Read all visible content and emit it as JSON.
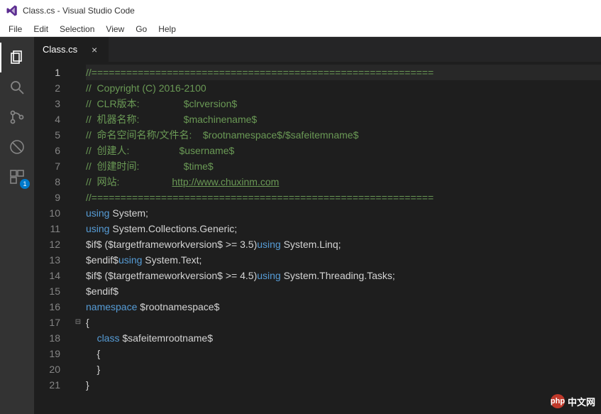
{
  "window": {
    "title": "Class.cs - Visual Studio Code"
  },
  "menu": {
    "file": "File",
    "edit": "Edit",
    "selection": "Selection",
    "view": "View",
    "go": "Go",
    "help": "Help"
  },
  "activity": {
    "explorer_badge": "1"
  },
  "tabs": {
    "tab0": {
      "label": "Class.cs"
    }
  },
  "editor": {
    "line_numbers": [
      "1",
      "2",
      "3",
      "4",
      "5",
      "6",
      "7",
      "8",
      "9",
      "10",
      "11",
      "12",
      "13",
      "14",
      "15",
      "16",
      "17",
      "18",
      "19",
      "20",
      "21"
    ],
    "current_line_index": 0,
    "fold_markers": {
      "17": "⊟"
    },
    "lines": [
      {
        "segments": [
          {
            "cls": "c-comment",
            "text": "//==========================================================="
          }
        ]
      },
      {
        "segments": [
          {
            "cls": "c-comment",
            "text": "//  Copyright (C) 2016-2100"
          }
        ]
      },
      {
        "segments": [
          {
            "cls": "c-comment",
            "text": "//  CLR版本:                $clrversion$"
          }
        ]
      },
      {
        "segments": [
          {
            "cls": "c-comment",
            "text": "//  机器名称:                $machinename$"
          }
        ]
      },
      {
        "segments": [
          {
            "cls": "c-comment",
            "text": "//  命名空间名称/文件名:    $rootnamespace$/$safeitemname$"
          }
        ]
      },
      {
        "segments": [
          {
            "cls": "c-comment",
            "text": "//  创建人:                  $username$"
          }
        ]
      },
      {
        "segments": [
          {
            "cls": "c-comment",
            "text": "//  创建时间:                $time$"
          }
        ]
      },
      {
        "segments": [
          {
            "cls": "c-comment",
            "text": "//  网站:                   "
          },
          {
            "cls": "c-link",
            "text": "http://www.chuxinm.com"
          }
        ]
      },
      {
        "segments": [
          {
            "cls": "c-comment",
            "text": "//==========================================================="
          }
        ]
      },
      {
        "segments": [
          {
            "cls": "c-keyword",
            "text": "using"
          },
          {
            "cls": "c-punc",
            "text": " System;"
          }
        ]
      },
      {
        "segments": [
          {
            "cls": "c-keyword",
            "text": "using"
          },
          {
            "cls": "c-punc",
            "text": " System.Collections.Generic;"
          }
        ]
      },
      {
        "segments": [
          {
            "cls": "c-punc",
            "text": "$if$ ($targetframeworkversion$ >= 3.5)"
          },
          {
            "cls": "c-keyword",
            "text": "using"
          },
          {
            "cls": "c-punc",
            "text": " System.Linq;"
          }
        ]
      },
      {
        "segments": [
          {
            "cls": "c-punc",
            "text": "$endif$"
          },
          {
            "cls": "c-keyword",
            "text": "using"
          },
          {
            "cls": "c-punc",
            "text": " System.Text;"
          }
        ]
      },
      {
        "segments": [
          {
            "cls": "c-punc",
            "text": "$if$ ($targetframeworkversion$ >= 4.5)"
          },
          {
            "cls": "c-keyword",
            "text": "using"
          },
          {
            "cls": "c-punc",
            "text": " System.Threading.Tasks;"
          }
        ]
      },
      {
        "segments": [
          {
            "cls": "c-punc",
            "text": "$endif$"
          }
        ]
      },
      {
        "segments": [
          {
            "cls": "c-keyword",
            "text": "namespace"
          },
          {
            "cls": "c-punc",
            "text": " $rootnamespace$"
          }
        ]
      },
      {
        "segments": [
          {
            "cls": "c-punc",
            "text": "{"
          }
        ]
      },
      {
        "segments": [
          {
            "cls": "c-punc",
            "text": "    "
          },
          {
            "cls": "c-keyword",
            "text": "class"
          },
          {
            "cls": "c-punc",
            "text": " $safeitemrootname$"
          }
        ]
      },
      {
        "segments": [
          {
            "cls": "c-punc",
            "text": "    {"
          }
        ]
      },
      {
        "segments": [
          {
            "cls": "c-punc",
            "text": "    }"
          }
        ]
      },
      {
        "segments": [
          {
            "cls": "c-punc",
            "text": "}"
          }
        ]
      }
    ]
  },
  "watermark": {
    "icon_text": "php",
    "label": "中文网"
  }
}
